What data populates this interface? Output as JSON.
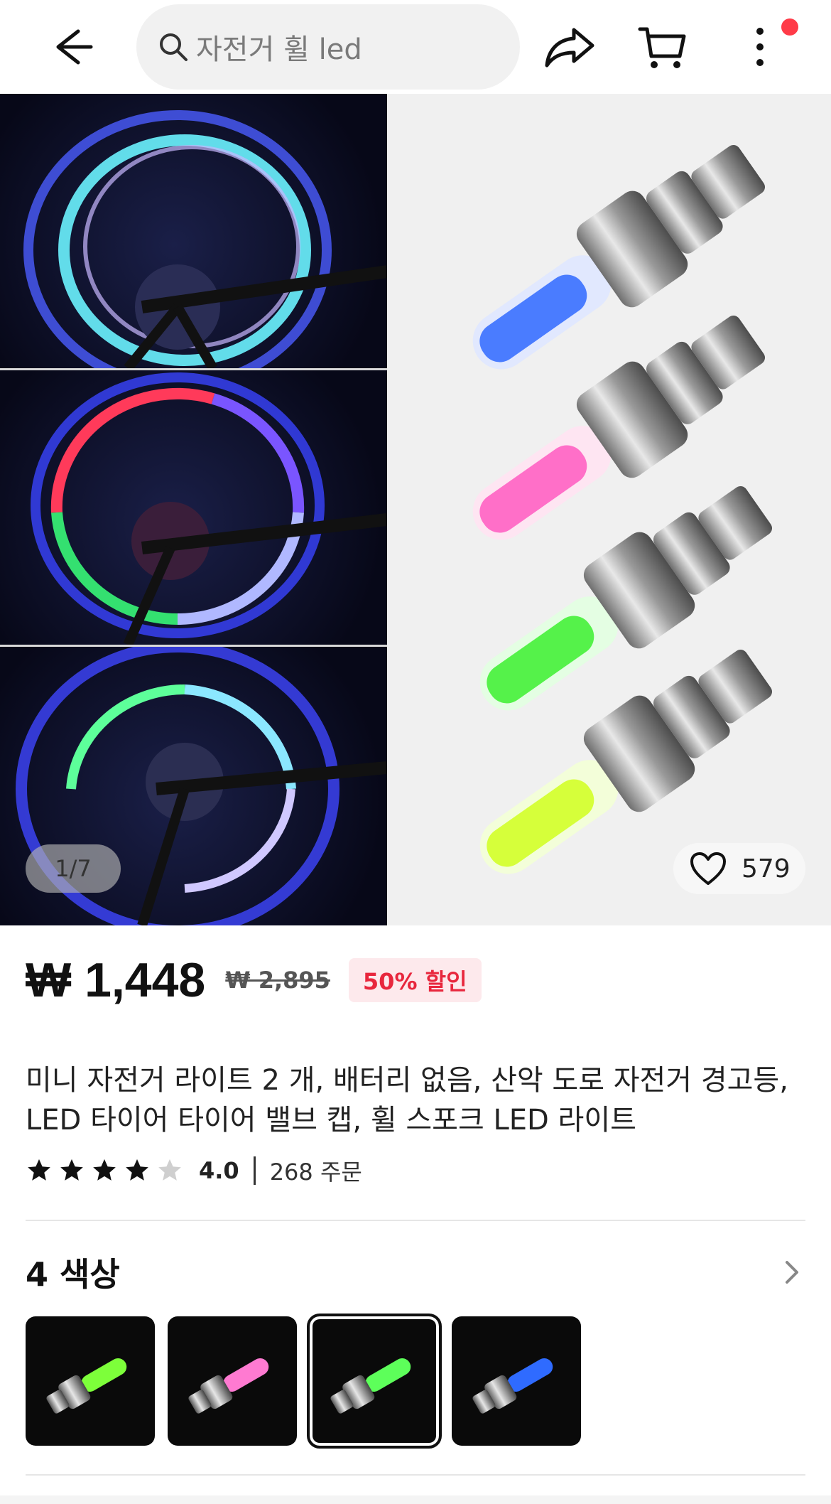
{
  "header": {
    "search_placeholder": "자전거 휠 led",
    "icons": [
      "back-arrow-icon",
      "search-icon",
      "share-icon",
      "cart-icon",
      "more-vertical-icon"
    ]
  },
  "gallery": {
    "page_indicator": "1/7",
    "like_count": "579"
  },
  "product": {
    "price": "₩ 1,448",
    "original_price": "₩ 2,895",
    "discount": "50% 할인",
    "title": "미니 자전거 라이트 2 개, 배터리 없음, 산악 도로 자전거 경고등, LED 타이어 타이어 밸브 캡, 휠 스포크 LED 라이트",
    "rating": "4.0",
    "rating_value": 4.0,
    "orders": "268 주문"
  },
  "colors": {
    "title": "4 색상",
    "swatches": [
      {
        "color": "#7dff3a",
        "selected": false
      },
      {
        "color": "#ff7ad1",
        "selected": false
      },
      {
        "color": "#5dff5a",
        "selected": true
      },
      {
        "color": "#2f6bff",
        "selected": false
      }
    ]
  },
  "theme": {
    "accent": "#e8273d",
    "discount_bg": "#fde9ec",
    "notification_dot": "#ff3b48"
  }
}
